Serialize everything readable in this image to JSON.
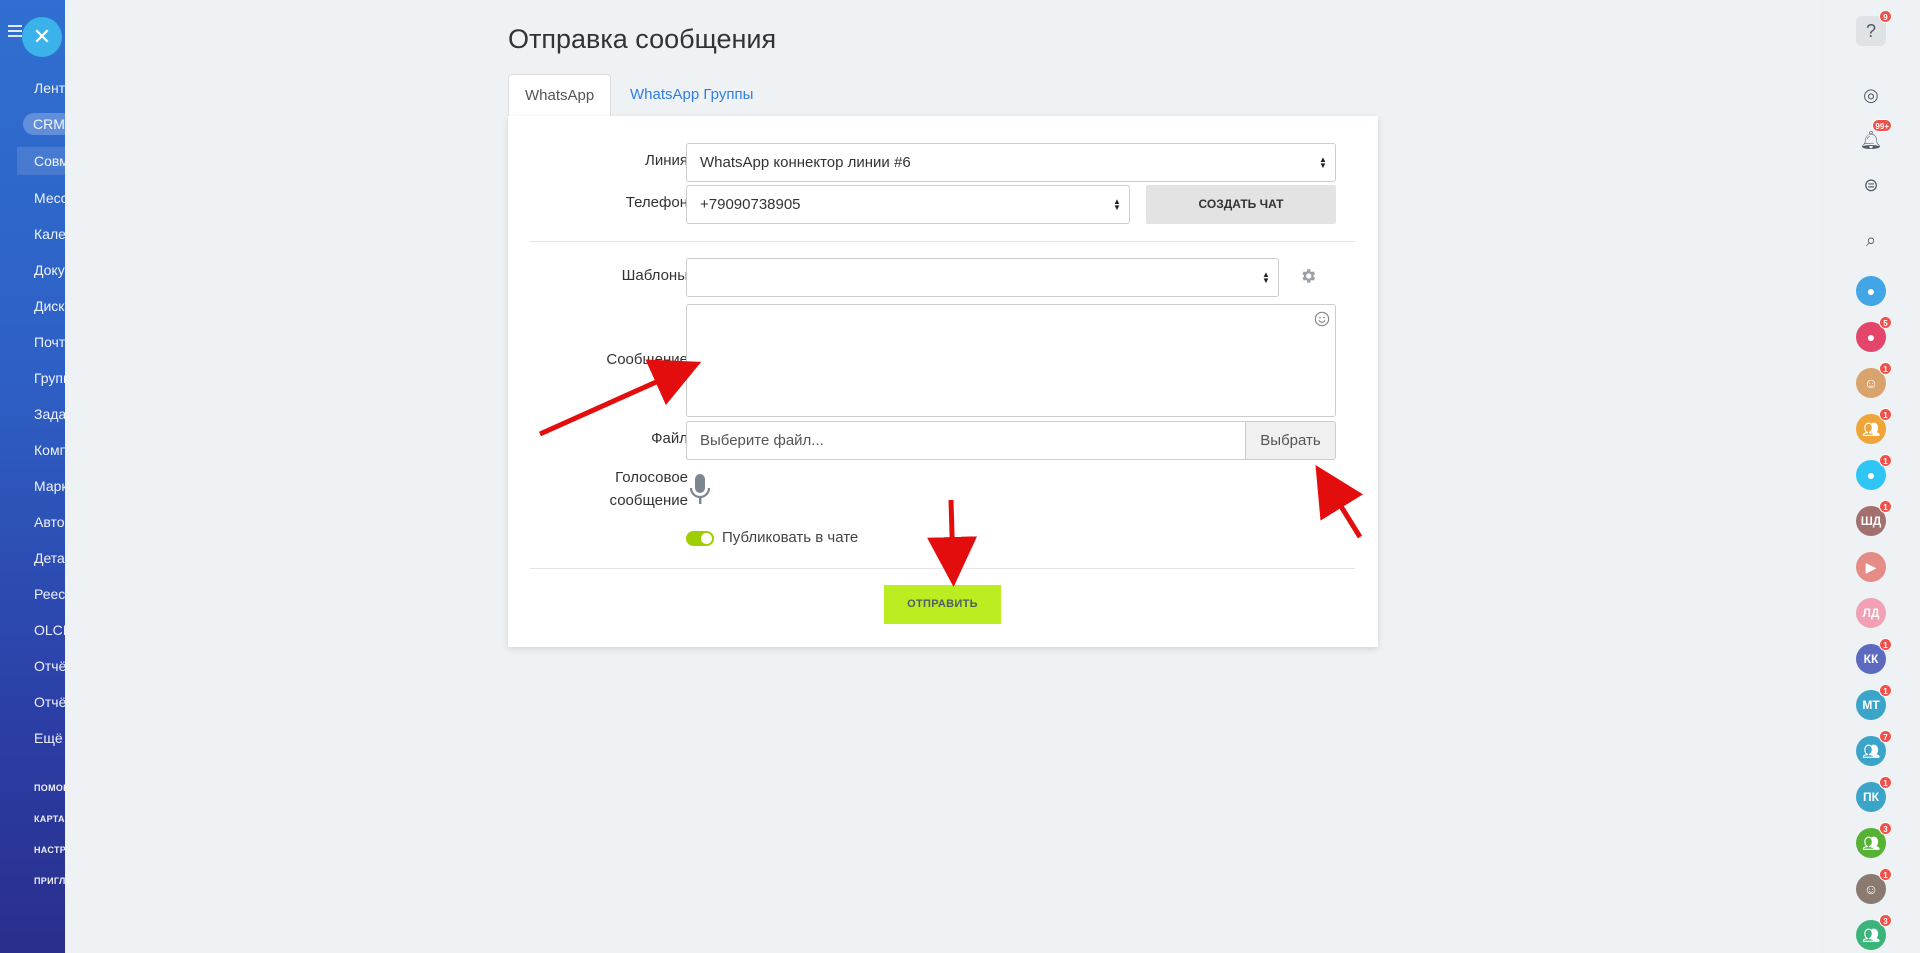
{
  "left_menu": {
    "items": [
      {
        "label": "Лента",
        "style": "normal"
      },
      {
        "label": "CRM",
        "style": "pill"
      },
      {
        "label": "Совместно",
        "style": "active-row"
      },
      {
        "label": "Мессенджер",
        "style": "normal"
      },
      {
        "label": "Календарь",
        "style": "normal"
      },
      {
        "label": "Документы",
        "style": "normal"
      },
      {
        "label": "Диск",
        "style": "normal"
      },
      {
        "label": "Почта",
        "style": "normal"
      },
      {
        "label": "Группы",
        "style": "normal"
      },
      {
        "label": "Задачи",
        "style": "normal"
      },
      {
        "label": "Компания",
        "style": "normal"
      },
      {
        "label": "Маркетинг",
        "style": "normal"
      },
      {
        "label": "Автоматизация",
        "style": "normal"
      },
      {
        "label": "Детали",
        "style": "normal"
      },
      {
        "label": "Реестр",
        "style": "normal"
      },
      {
        "label": "OLCI",
        "style": "normal"
      },
      {
        "label": "Отчёты",
        "style": "normal"
      },
      {
        "label": "Отчёты",
        "style": "normal"
      },
      {
        "label": "Ещё",
        "style": "normal"
      }
    ],
    "footer_items": [
      "ПОМОЩЬ",
      "КАРТА",
      "НАСТРОЙКИ",
      "ПРИГЛАСИТЬ"
    ],
    "close_glyph": "✕"
  },
  "page": {
    "title": "Отправка сообщения",
    "tabs": [
      {
        "label": "WhatsApp",
        "active": true
      },
      {
        "label": "WhatsApp Группы",
        "active": false
      }
    ]
  },
  "form": {
    "line_label": "Линия",
    "line_value": "WhatsApp коннектор линии #6",
    "phone_label": "Телефон",
    "phone_value": "+79090738905",
    "create_chat_label": "СОЗДАТЬ ЧАТ",
    "templates_label": "Шаблоны",
    "templates_value": "",
    "message_label": "Сообщение",
    "file_label": "Файл",
    "file_placeholder": "Выберите файл...",
    "file_button": "Выбрать",
    "voice_label_line1": "Голосовое",
    "voice_label_line2": "сообщение",
    "publish_label": "Публиковать в чате",
    "publish_on": true,
    "send_label": "ОТПРАВИТЬ"
  },
  "right_bar": {
    "help_badge": "9",
    "notifications_badge": "99+",
    "contacts": [
      {
        "initials": "",
        "color": "#41a5e6",
        "badge": "",
        "icon": "target-icon"
      },
      {
        "initials": "",
        "color": "#e3466a",
        "badge": "5",
        "icon": "instagram-icon"
      },
      {
        "initials": "",
        "color": "#d9a36e",
        "badge": "1",
        "icon": "avatar-photo"
      },
      {
        "initials": "",
        "color": "#f0a53a",
        "badge": "1",
        "icon": "chat-group-icon"
      },
      {
        "initials": "",
        "color": "#2fc6f6",
        "badge": "1",
        "icon": "chat-bubble-icon"
      },
      {
        "initials": "ШД",
        "color": "#a2706f",
        "badge": "1",
        "icon": ""
      },
      {
        "initials": "",
        "color": "#e58c87",
        "badge": "",
        "icon": "video-icon"
      },
      {
        "initials": "ЛД",
        "color": "#f2a0b4",
        "badge": "",
        "icon": ""
      },
      {
        "initials": "КК",
        "color": "#5c6bc0",
        "badge": "1",
        "icon": ""
      },
      {
        "initials": "МТ",
        "color": "#3aa4c9",
        "badge": "1",
        "icon": ""
      },
      {
        "initials": "",
        "color": "#3aa4c9",
        "badge": "7",
        "icon": "group-icon"
      },
      {
        "initials": "ПК",
        "color": "#3aa4c9",
        "badge": "1",
        "icon": ""
      },
      {
        "initials": "",
        "color": "#56b134",
        "badge": "3",
        "icon": "group-icon"
      },
      {
        "initials": "",
        "color": "#8a7a70",
        "badge": "1",
        "icon": "avatar-photo"
      },
      {
        "initials": "",
        "color": "#3bb47a",
        "badge": "3",
        "icon": "group-icon"
      }
    ]
  },
  "colors": {
    "accent_link": "#2f7ee8",
    "send_button": "#bbed21",
    "toggle_on": "#9dcf00",
    "arrow_annotation": "#e30d0d",
    "badge": "#f0514a"
  }
}
